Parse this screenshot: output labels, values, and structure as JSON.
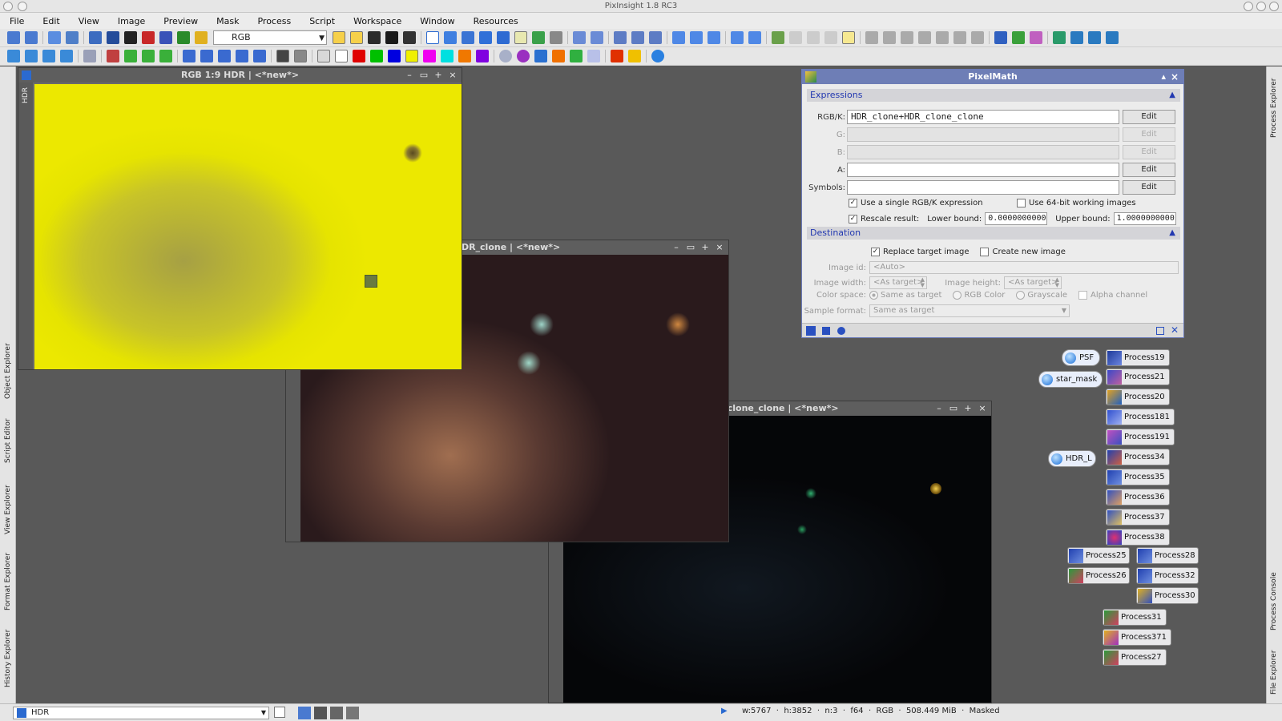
{
  "window": {
    "title": "PixInsight 1.8 RC3"
  },
  "menubar": {
    "items": [
      "File",
      "Edit",
      "View",
      "Image",
      "Preview",
      "Mask",
      "Process",
      "Script",
      "Workspace",
      "Window",
      "Resources"
    ]
  },
  "toolbar": {
    "view_select": "RGB"
  },
  "left_dock": {
    "tabs": [
      "Object Explorer",
      "Script Editor",
      "View Explorer",
      "Format Explorer",
      "History Explorer"
    ]
  },
  "right_dock": {
    "tabs": [
      "Process Explorer",
      "Process Console",
      "File Explorer"
    ]
  },
  "windows": {
    "hdr": {
      "title": "RGB 1:9 HDR | <*new*>",
      "side_label": "HDR"
    },
    "mid": {
      "title": "HDR_clone | <*new*>"
    },
    "low": {
      "title": "HDR_clone_clone | <*new*>"
    }
  },
  "pixelmath": {
    "title": "PixelMath",
    "expressions_section": "Expressions",
    "rgbk_label": "RGB/K:",
    "rgbk_value": "HDR_clone+HDR_clone_clone",
    "g_label": "G:",
    "b_label": "B:",
    "a_label": "A:",
    "symbols_label": "Symbols:",
    "edit_label": "Edit",
    "single_expr_label": "Use a single RGB/K expression",
    "use64_label": "Use 64-bit working images",
    "rescale_label": "Rescale result:",
    "lower_bound_label": "Lower bound:",
    "lower_bound_value": "0.0000000000",
    "upper_bound_label": "Upper bound:",
    "upper_bound_value": "1.0000000000",
    "destination_section": "Destination",
    "replace_target_label": "Replace target image",
    "create_new_label": "Create new image",
    "image_id_label": "Image id:",
    "image_id_value": "<Auto>",
    "image_width_label": "Image width:",
    "image_width_value": "<As target>",
    "image_height_label": "Image height:",
    "image_height_value": "<As target>",
    "color_space_label": "Color space:",
    "color_space_options": [
      "Same as target",
      "RGB Color",
      "Grayscale"
    ],
    "alpha_channel_label": "Alpha channel",
    "sample_format_label": "Sample format:",
    "sample_format_value": "Same as target"
  },
  "icons": {
    "psf": "PSF",
    "star_mask": "star_mask",
    "hdr_l": "HDR_L",
    "process19": "Process19",
    "process21": "Process21",
    "process20": "Process20",
    "process181": "Process181",
    "process191": "Process191",
    "process34": "Process34",
    "process35": "Process35",
    "process36": "Process36",
    "process37": "Process37",
    "process38": "Process38",
    "process25": "Process25",
    "process28": "Process28",
    "process26": "Process26",
    "process32": "Process32",
    "process30": "Process30",
    "process31": "Process31",
    "process371": "Process371",
    "process27": "Process27"
  },
  "statusbar": {
    "view": "HDR",
    "info": "w:5767  ·  h:3852  ·  n:3  ·  f64  ·  RGB  ·  508.449 MiB  ·  Masked"
  }
}
